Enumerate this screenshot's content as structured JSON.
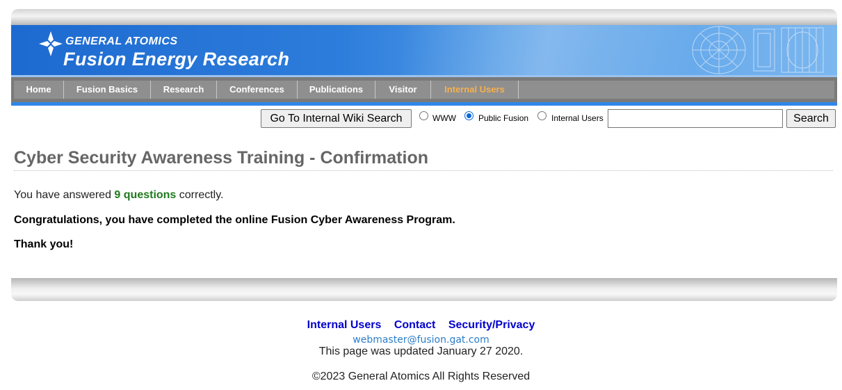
{
  "header": {
    "logo_line1": "GENERAL ATOMICS",
    "logo_line2": "Fusion Energy Research"
  },
  "nav": {
    "items": [
      {
        "label": "Home"
      },
      {
        "label": "Fusion Basics"
      },
      {
        "label": "Research"
      },
      {
        "label": "Conferences"
      },
      {
        "label": "Publications"
      },
      {
        "label": "Visitor"
      },
      {
        "label": "Internal Users",
        "active": true
      }
    ]
  },
  "search": {
    "wiki_button": "Go To Internal Wiki Search",
    "scope_options": [
      {
        "label": "WWW",
        "selected": false
      },
      {
        "label": "Public Fusion",
        "selected": true
      },
      {
        "label": "Internal Users",
        "selected": false
      }
    ],
    "query": "",
    "button": "Search"
  },
  "main": {
    "title": "Cyber Security Awareness Training - Confirmation",
    "answered_prefix": "You have answered",
    "answered_count": "9 questions",
    "answered_suffix": "correctly.",
    "congrats": "Congratulations, you have completed the online Fusion Cyber Awareness Program.",
    "thanks": "Thank you!"
  },
  "footer": {
    "links": [
      "Internal Users",
      "Contact",
      "Security/Privacy"
    ],
    "email": "webmaster@fusion.gat.com",
    "updated": "This page was updated January 27 2020.",
    "copyright": "©2023 General Atomics All Rights Reserved"
  },
  "colors": {
    "banner_blue": "#2d7ddc",
    "nav_gray": "#8f8f8f",
    "nav_active": "#f7b04b",
    "title_gray": "#666666",
    "count_green": "#1f7a1f",
    "link_blue": "#0000cc"
  }
}
